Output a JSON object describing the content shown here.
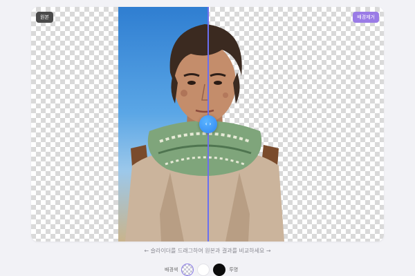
{
  "labels": {
    "original": "원본",
    "removed": "배경제거"
  },
  "slider": {
    "handle_glyph": "‹ ›",
    "position": 0.5
  },
  "hint": "← 슬라이더를 드래그하여 원본과 결과를 비교하세요 →",
  "background_picker": {
    "label": "배경색",
    "options": [
      {
        "name": "transparent",
        "color": "checkerboard",
        "selected": true
      },
      {
        "name": "white",
        "color": "#ffffff",
        "selected": false
      },
      {
        "name": "black",
        "color": "#0c0c0c",
        "selected": false
      }
    ],
    "trailing_label": "투명"
  },
  "colors": {
    "accent": "#6b6ff0",
    "removed_badge": "#9a7be6",
    "handle": "#2f84f2"
  }
}
